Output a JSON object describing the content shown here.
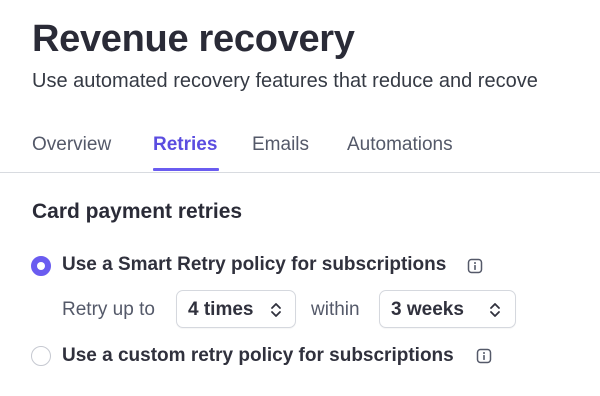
{
  "header": {
    "title": "Revenue recovery",
    "subtitle": "Use automated recovery features that reduce and recove"
  },
  "tabs": [
    {
      "label": "Overview",
      "active": false
    },
    {
      "label": "Retries",
      "active": true
    },
    {
      "label": "Emails",
      "active": false
    },
    {
      "label": "Automations",
      "active": false
    }
  ],
  "section": {
    "title": "Card payment retries"
  },
  "options": {
    "smart": {
      "label": "Use a Smart Retry policy for subscriptions",
      "selected": true,
      "icon": "info-icon"
    },
    "custom": {
      "label": "Use a custom retry policy for subscriptions",
      "selected": false,
      "icon": "info-icon"
    }
  },
  "retry_config": {
    "prefix": "Retry up to",
    "times_value": "4 times",
    "connector": "within",
    "period_value": "3 weeks"
  },
  "colors": {
    "accent": "#6a5cf0",
    "active_tab_text": "#5b4de0",
    "text_dark": "#2a2b37",
    "text_muted": "#545969",
    "border": "#d8dbe0"
  }
}
